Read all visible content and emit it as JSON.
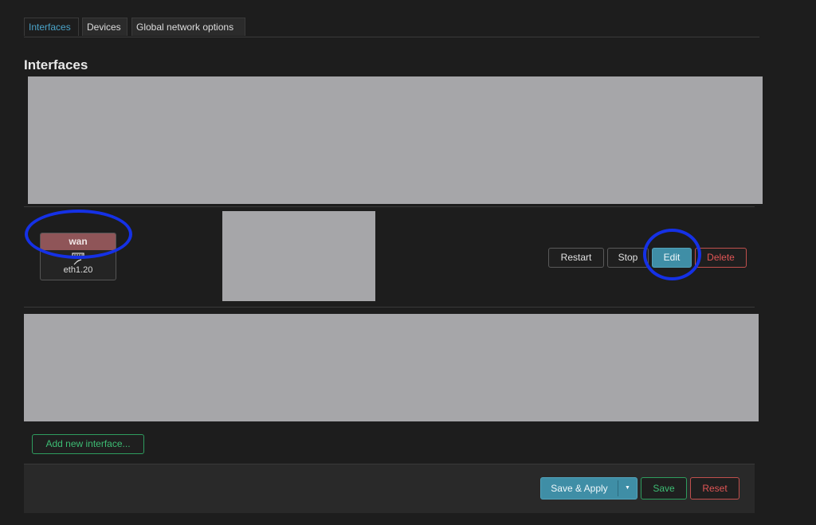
{
  "tabs": [
    {
      "label": "Interfaces",
      "active": true
    },
    {
      "label": "Devices",
      "active": false
    },
    {
      "label": "Global network options",
      "active": false
    }
  ],
  "section_title": "Interfaces",
  "interface": {
    "name": "wan",
    "device": "eth1.20",
    "icon": "ethernet-port-icon",
    "name_color": "#8f5558"
  },
  "row_actions": {
    "restart": "Restart",
    "stop": "Stop",
    "edit": "Edit",
    "delete": "Delete"
  },
  "add_interface_label": "Add new interface...",
  "footer": {
    "save_apply": "Save & Apply",
    "save_apply_caret": "▼",
    "save": "Save",
    "reset": "Reset"
  },
  "annotations": {
    "color": "#1531e6",
    "highlighted": [
      "wan",
      "Edit"
    ]
  },
  "colors": {
    "accent": "#3f8ea6",
    "positive": "#2e9c5e",
    "negative": "#c0504d"
  }
}
